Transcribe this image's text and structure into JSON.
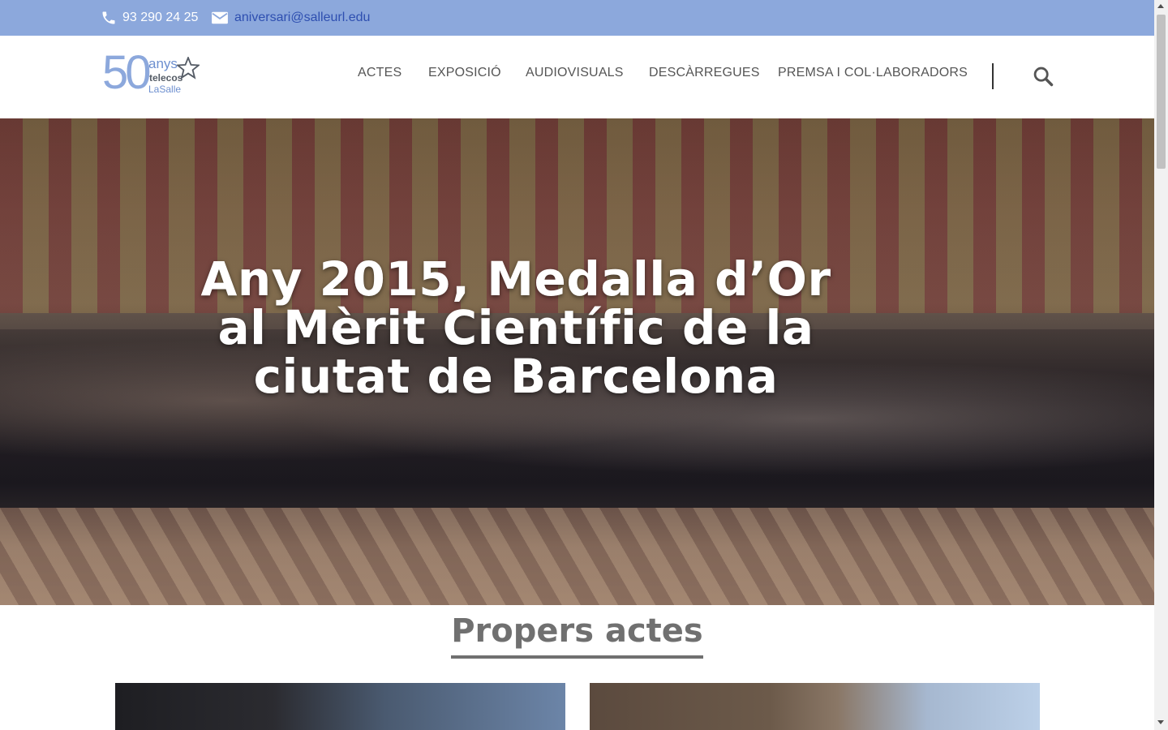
{
  "topbar": {
    "phone": "93 290 24 25",
    "email": "aniversari@salleurl.edu"
  },
  "logo": {
    "number": "50",
    "line1": "anys",
    "line2": "telecos",
    "line3": "LaSalle"
  },
  "nav": {
    "items": [
      {
        "label": "ACTES"
      },
      {
        "label": "EXPOSICIÓ"
      },
      {
        "label": "AUDIOVISUALS"
      },
      {
        "label": "DESCÀRREGUES"
      },
      {
        "label": "PREMSA I COL·LABORADORS"
      }
    ],
    "search_icon": "search-icon"
  },
  "hero": {
    "title": "Any 2015, Medalla d’Or al Mèrit Científic de la ciutat de Barcelona"
  },
  "section": {
    "title": "Propers actes"
  },
  "colors": {
    "topbar": "#8ca8dc",
    "email_link": "#2e4fb0",
    "nav_text": "#555555",
    "section_title": "#707070"
  }
}
